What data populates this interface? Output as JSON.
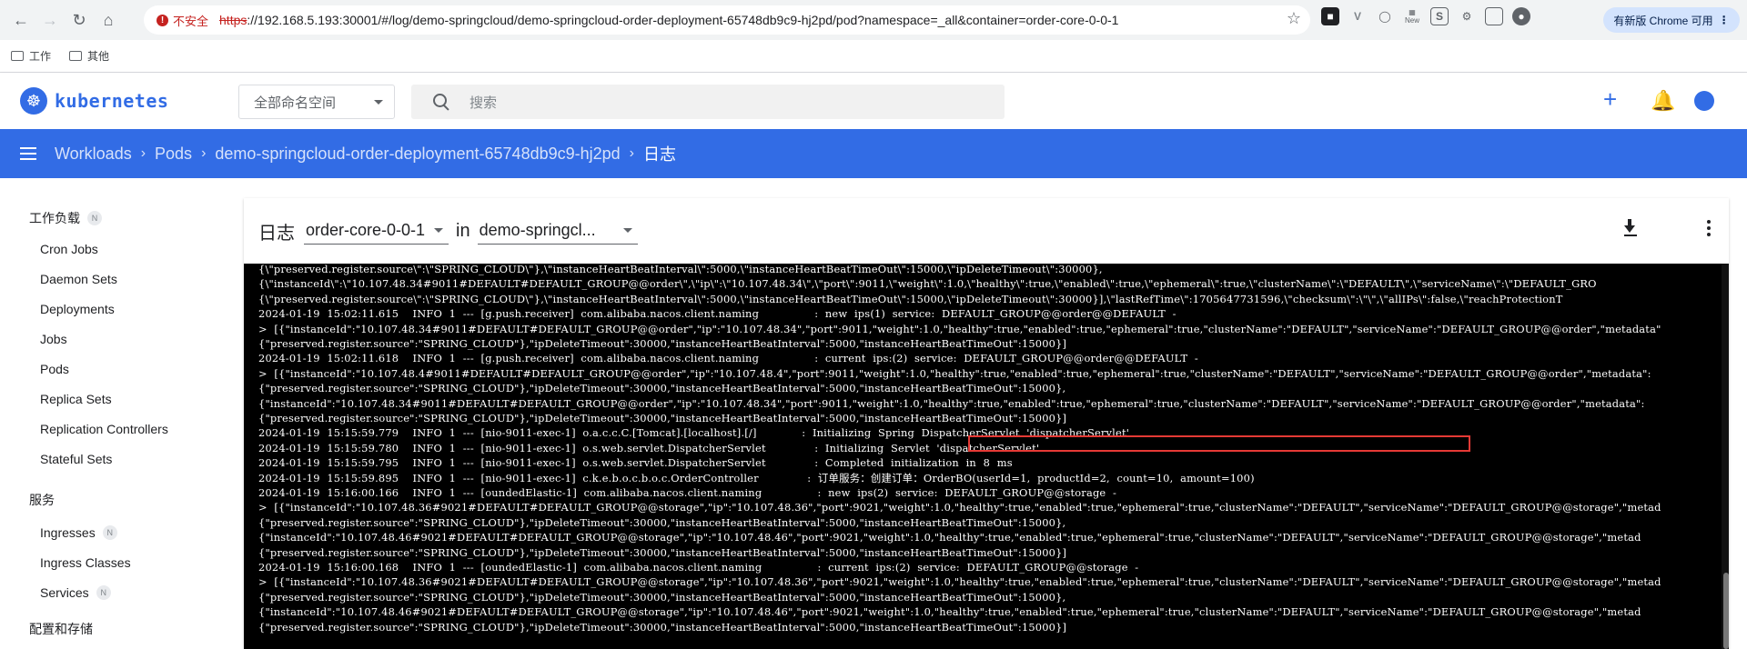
{
  "browser": {
    "url_scheme": "https",
    "url_rest": "://192.168.5.193:30001/#/log/demo-springcloud/demo-springcloud-order-deployment-65748db9c9-hj2pd/pod?namespace=_all&container=order-core-0-0-1",
    "insecure_label": "不安全",
    "update_label": "有新版 Chrome 可用",
    "ext_new_label": "New",
    "bookmarks": [
      "工作",
      "其他"
    ]
  },
  "header": {
    "logo_text": "kubernetes",
    "namespace_selector": "全部命名空间",
    "search_placeholder": "搜索"
  },
  "breadcrumb": [
    "Workloads",
    "Pods",
    "demo-springcloud-order-deployment-65748db9c9-hj2pd",
    "日志"
  ],
  "sidebar": {
    "section_workloads": "工作负载",
    "workload_items": [
      "Cron Jobs",
      "Daemon Sets",
      "Deployments",
      "Jobs",
      "Pods",
      "Replica Sets",
      "Replication Controllers",
      "Stateful Sets"
    ],
    "section_service": "服务",
    "service_items": [
      "Ingresses",
      "Ingress Classes",
      "Services"
    ],
    "section_config": "配置和存储",
    "badge": "N"
  },
  "log": {
    "title": "日志",
    "container": "order-core-0-0-1",
    "in_word": "in",
    "pod_short": "demo-springcl...",
    "lines": [
      "{\\\"preserved.register.source\\\":\\\"SPRING_CLOUD\\\"},\\\"instanceHeartBeatInterval\\\":5000,\\\"instanceHeartBeatTimeOut\\\":15000,\\\"ipDeleteTimeout\\\":30000},",
      "{\\\"instanceId\\\":\\\"10.107.48.34#9011#DEFAULT#DEFAULT_GROUP@@order\\\",\\\"ip\\\":\\\"10.107.48.34\\\",\\\"port\\\":9011,\\\"weight\\\":1.0,\\\"healthy\\\":true,\\\"enabled\\\":true,\\\"ephemeral\\\":true,\\\"clusterName\\\":\\\"DEFAULT\\\",\\\"serviceName\\\":\\\"DEFAULT_GRO",
      "{\\\"preserved.register.source\\\":\\\"SPRING_CLOUD\\\"},\\\"instanceHeartBeatInterval\\\":5000,\\\"instanceHeartBeatTimeOut\\\":15000,\\\"ipDeleteTimeout\\\":30000}],\\\"lastRefTime\\\":1705647731596,\\\"checksum\\\":\\\"\\\",\\\"allIPs\\\":false,\\\"reachProtectionT",
      "2024-01-19  15:02:11.615    INFO  1  ---  [g.push.receiver]  com.alibaba.nacos.client.naming                :  new  ips(1)  service:  DEFAULT_GROUP@@order@@DEFAULT  -",
      ">  [{\"instanceId\":\"10.107.48.34#9011#DEFAULT#DEFAULT_GROUP@@order\",\"ip\":\"10.107.48.34\",\"port\":9011,\"weight\":1.0,\"healthy\":true,\"enabled\":true,\"ephemeral\":true,\"clusterName\":\"DEFAULT\",\"serviceName\":\"DEFAULT_GROUP@@order\",\"metadata\"",
      "{\"preserved.register.source\":\"SPRING_CLOUD\"},\"ipDeleteTimeout\":30000,\"instanceHeartBeatInterval\":5000,\"instanceHeartBeatTimeOut\":15000}]",
      "2024-01-19  15:02:11.618    INFO  1  ---  [g.push.receiver]  com.alibaba.nacos.client.naming                :  current  ips:(2)  service:  DEFAULT_GROUP@@order@@DEFAULT  -",
      ">  [{\"instanceId\":\"10.107.48.4#9011#DEFAULT#DEFAULT_GROUP@@order\",\"ip\":\"10.107.48.4\",\"port\":9011,\"weight\":1.0,\"healthy\":true,\"enabled\":true,\"ephemeral\":true,\"clusterName\":\"DEFAULT\",\"serviceName\":\"DEFAULT_GROUP@@order\",\"metadata\":",
      "{\"preserved.register.source\":\"SPRING_CLOUD\"},\"ipDeleteTimeout\":30000,\"instanceHeartBeatInterval\":5000,\"instanceHeartBeatTimeOut\":15000},",
      "{\"instanceId\":\"10.107.48.34#9011#DEFAULT#DEFAULT_GROUP@@order\",\"ip\":\"10.107.48.34\",\"port\":9011,\"weight\":1.0,\"healthy\":true,\"enabled\":true,\"ephemeral\":true,\"clusterName\":\"DEFAULT\",\"serviceName\":\"DEFAULT_GROUP@@order\",\"metadata\":",
      "{\"preserved.register.source\":\"SPRING_CLOUD\"},\"ipDeleteTimeout\":30000,\"instanceHeartBeatInterval\":5000,\"instanceHeartBeatTimeOut\":15000}]",
      "2024-01-19  15:15:59.779    INFO  1  ---  [nio-9011-exec-1]  o.a.c.c.C.[Tomcat].[localhost].[/]             :  Initializing  Spring  DispatcherServlet  'dispatcherServlet'",
      "2024-01-19  15:15:59.780    INFO  1  ---  [nio-9011-exec-1]  o.s.web.servlet.DispatcherServlet              :  Initializing  Servlet  'dispatcherServlet'",
      "2024-01-19  15:15:59.795    INFO  1  ---  [nio-9011-exec-1]  o.s.web.servlet.DispatcherServlet              :  Completed  initialization  in  8  ms",
      "2024-01-19  15:15:59.895    INFO  1  ---  [nio-9011-exec-1]  c.k.e.b.o.c.b.o.c.OrderController              :  订单服务：创建订单：OrderBO(userId=1,  productId=2,  count=10,  amount=100)",
      "2024-01-19  15:16:00.166    INFO  1  ---  [oundedElastic-1]  com.alibaba.nacos.client.naming                :  new  ips(2)  service:  DEFAULT_GROUP@@storage  -",
      ">  [{\"instanceId\":\"10.107.48.36#9021#DEFAULT#DEFAULT_GROUP@@storage\",\"ip\":\"10.107.48.36\",\"port\":9021,\"weight\":1.0,\"healthy\":true,\"enabled\":true,\"ephemeral\":true,\"clusterName\":\"DEFAULT\",\"serviceName\":\"DEFAULT_GROUP@@storage\",\"metad",
      "{\"preserved.register.source\":\"SPRING_CLOUD\"},\"ipDeleteTimeout\":30000,\"instanceHeartBeatInterval\":5000,\"instanceHeartBeatTimeOut\":15000},",
      "{\"instanceId\":\"10.107.48.46#9021#DEFAULT#DEFAULT_GROUP@@storage\",\"ip\":\"10.107.48.46\",\"port\":9021,\"weight\":1.0,\"healthy\":true,\"enabled\":true,\"ephemeral\":true,\"clusterName\":\"DEFAULT\",\"serviceName\":\"DEFAULT_GROUP@@storage\",\"metad",
      "{\"preserved.register.source\":\"SPRING_CLOUD\"},\"ipDeleteTimeout\":30000,\"instanceHeartBeatInterval\":5000,\"instanceHeartBeatTimeOut\":15000}]",
      "2024-01-19  15:16:00.168    INFO  1  ---  [oundedElastic-1]  com.alibaba.nacos.client.naming                :  current  ips:(2)  service:  DEFAULT_GROUP@@storage  -",
      ">  [{\"instanceId\":\"10.107.48.36#9021#DEFAULT#DEFAULT_GROUP@@storage\",\"ip\":\"10.107.48.36\",\"port\":9021,\"weight\":1.0,\"healthy\":true,\"enabled\":true,\"ephemeral\":true,\"clusterName\":\"DEFAULT\",\"serviceName\":\"DEFAULT_GROUP@@storage\",\"metad",
      "{\"preserved.register.source\":\"SPRING_CLOUD\"},\"ipDeleteTimeout\":30000,\"instanceHeartBeatInterval\":5000,\"instanceHeartBeatTimeOut\":15000},",
      "{\"instanceId\":\"10.107.48.46#9021#DEFAULT#DEFAULT_GROUP@@storage\",\"ip\":\"10.107.48.46\",\"port\":9021,\"weight\":1.0,\"healthy\":true,\"enabled\":true,\"ephemeral\":true,\"clusterName\":\"DEFAULT\",\"serviceName\":\"DEFAULT_GROUP@@storage\",\"metad",
      "{\"preserved.register.source\":\"SPRING_CLOUD\"},\"ipDeleteTimeout\":30000,\"instanceHeartBeatInterval\":5000,\"instanceHeartBeatTimeOut\":15000}]"
    ]
  },
  "colors": {
    "brand": "#326ce5",
    "highlight": "#e53935",
    "log_bg": "#000000",
    "log_text": "#ffffff"
  }
}
